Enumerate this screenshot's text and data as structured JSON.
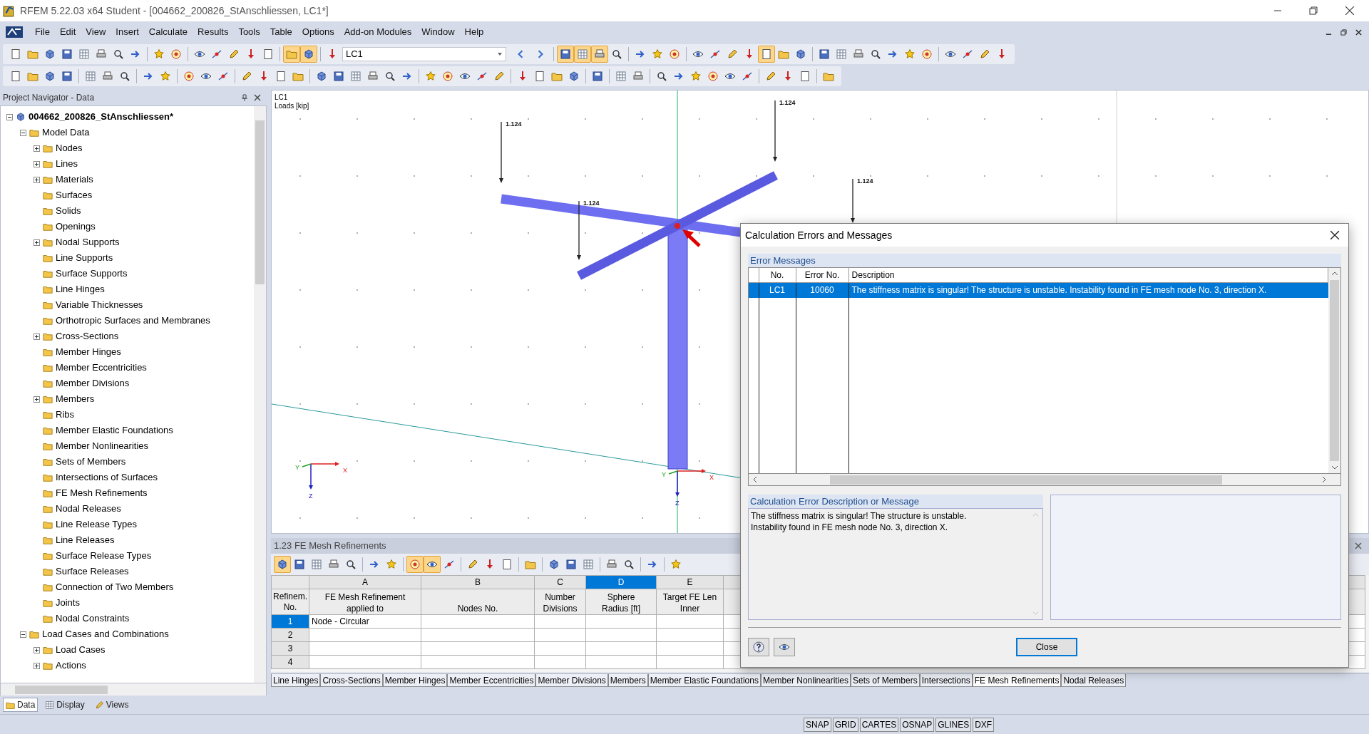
{
  "window": {
    "title": "RFEM 5.22.03 x64 Student - [004662_200826_StAnschliessen, LC1*]"
  },
  "menu": [
    "File",
    "Edit",
    "View",
    "Insert",
    "Calculate",
    "Results",
    "Tools",
    "Table",
    "Options",
    "Add-on Modules",
    "Window",
    "Help"
  ],
  "toolbar": {
    "load_case": "LC1",
    "buttons": [
      {
        "on": false
      },
      {
        "on": false
      },
      {
        "on": false
      },
      {
        "on": false
      },
      {
        "on": false
      },
      {
        "on": false
      },
      {
        "on": false
      },
      {
        "on": false
      },
      {
        "on": false
      },
      {
        "on": false
      },
      {
        "on": false
      },
      {
        "on": false
      },
      {
        "on": false
      },
      {
        "on": false
      },
      {
        "on": false
      },
      {
        "on": true
      },
      {
        "on": true
      },
      {
        "on": true
      },
      {
        "on": true
      },
      {
        "on": true
      },
      {
        "on": false
      },
      {
        "on": false
      },
      {
        "on": false
      },
      {
        "on": false
      },
      {
        "on": false
      },
      {
        "on": false
      },
      {
        "on": false
      },
      {
        "on": false
      },
      {
        "on": true
      },
      {
        "on": false
      },
      {
        "on": false
      },
      {
        "on": false
      },
      {
        "on": false
      },
      {
        "on": false
      },
      {
        "on": false
      },
      {
        "on": false
      },
      {
        "on": false
      },
      {
        "on": false
      },
      {
        "on": false
      },
      {
        "on": false
      },
      {
        "on": false
      },
      {
        "on": false
      }
    ]
  },
  "navigator": {
    "title": "Project Navigator - Data",
    "tree": [
      {
        "label": "004662_200826_StAnschliessen*",
        "kind": "group",
        "expanded": true,
        "children": [
          {
            "label": "Model Data",
            "kind": "group",
            "expanded": true,
            "children": [
              {
                "label": "Nodes",
                "kind": "group",
                "expanded": false
              },
              {
                "label": "Lines",
                "kind": "group",
                "expanded": false
              },
              {
                "label": "Materials",
                "kind": "group",
                "expanded": false
              },
              {
                "label": "Surfaces",
                "kind": "leaf"
              },
              {
                "label": "Solids",
                "kind": "leaf"
              },
              {
                "label": "Openings",
                "kind": "leaf"
              },
              {
                "label": "Nodal Supports",
                "kind": "group",
                "expanded": false
              },
              {
                "label": "Line Supports",
                "kind": "leaf"
              },
              {
                "label": "Surface Supports",
                "kind": "leaf"
              },
              {
                "label": "Line Hinges",
                "kind": "leaf"
              },
              {
                "label": "Variable Thicknesses",
                "kind": "leaf"
              },
              {
                "label": "Orthotropic Surfaces and Membranes",
                "kind": "leaf"
              },
              {
                "label": "Cross-Sections",
                "kind": "group",
                "expanded": false
              },
              {
                "label": "Member Hinges",
                "kind": "leaf"
              },
              {
                "label": "Member Eccentricities",
                "kind": "leaf"
              },
              {
                "label": "Member Divisions",
                "kind": "leaf"
              },
              {
                "label": "Members",
                "kind": "group",
                "expanded": false
              },
              {
                "label": "Ribs",
                "kind": "leaf"
              },
              {
                "label": "Member Elastic Foundations",
                "kind": "leaf"
              },
              {
                "label": "Member Nonlinearities",
                "kind": "leaf"
              },
              {
                "label": "Sets of Members",
                "kind": "leaf"
              },
              {
                "label": "Intersections of Surfaces",
                "kind": "leaf"
              },
              {
                "label": "FE Mesh Refinements",
                "kind": "leaf"
              },
              {
                "label": "Nodal Releases",
                "kind": "leaf"
              },
              {
                "label": "Line Release Types",
                "kind": "leaf"
              },
              {
                "label": "Line Releases",
                "kind": "leaf"
              },
              {
                "label": "Surface Release Types",
                "kind": "leaf"
              },
              {
                "label": "Surface Releases",
                "kind": "leaf"
              },
              {
                "label": "Connection of Two Members",
                "kind": "leaf"
              },
              {
                "label": "Joints",
                "kind": "leaf"
              },
              {
                "label": "Nodal Constraints",
                "kind": "leaf"
              }
            ]
          },
          {
            "label": "Load Cases and Combinations",
            "kind": "group",
            "expanded": true,
            "children": [
              {
                "label": "Load Cases",
                "kind": "group",
                "expanded": false
              },
              {
                "label": "Actions",
                "kind": "group",
                "expanded": false
              }
            ]
          }
        ]
      }
    ],
    "tabs": [
      {
        "label": "Data",
        "selected": true
      },
      {
        "label": "Display",
        "selected": false
      },
      {
        "label": "Views",
        "selected": false
      }
    ]
  },
  "viewport": {
    "case": "LC1",
    "units": "Loads [kip]",
    "load_labels": [
      "1.124",
      "1.124",
      "1.124",
      "1.124"
    ],
    "axes": [
      {
        "x": "X",
        "y": "Y",
        "z": "Z"
      },
      {
        "x": "X",
        "y": "Y",
        "z": "Z"
      }
    ]
  },
  "table_panel": {
    "title": "1.23 FE Mesh Refinements",
    "toolbar": [
      {
        "on": true
      },
      {
        "on": false
      },
      {
        "on": false
      },
      {
        "on": false
      },
      {
        "on": false
      },
      {
        "on": false
      },
      {
        "on": false
      },
      {
        "on": true
      },
      {
        "on": true
      },
      {
        "on": false
      },
      {
        "on": false
      },
      {
        "on": false
      },
      {
        "on": false
      },
      {
        "on": false
      },
      {
        "on": false
      },
      {
        "on": false
      },
      {
        "on": false
      },
      {
        "on": false
      },
      {
        "on": false
      },
      {
        "on": false
      },
      {
        "on": false
      }
    ],
    "row_header": [
      "Refinem.",
      "No."
    ],
    "columns": [
      {
        "letter": "A",
        "selected": false,
        "heading": [
          "FE Mesh Refinement",
          "applied to"
        ]
      },
      {
        "letter": "B",
        "selected": false,
        "heading": [
          "Nodes No."
        ]
      },
      {
        "letter": "C",
        "selected": false,
        "heading": [
          "Number",
          "Divisions"
        ]
      },
      {
        "letter": "D",
        "selected": true,
        "heading": [
          "Sphere",
          "Radius [ft]"
        ]
      },
      {
        "letter": "E",
        "selected": false,
        "heading": [
          "Target FE Len",
          "Inner"
        ]
      }
    ],
    "rows": [
      {
        "no": "1",
        "selected": true,
        "applied_to": "Node - Circular"
      },
      {
        "no": "2",
        "selected": false
      },
      {
        "no": "3",
        "selected": false
      },
      {
        "no": "4",
        "selected": false
      }
    ],
    "sheet_tabs": [
      {
        "label": "Line Hinges",
        "selected": false
      },
      {
        "label": "Cross-Sections",
        "selected": false
      },
      {
        "label": "Member Hinges",
        "selected": false
      },
      {
        "label": "Member Eccentricities",
        "selected": false
      },
      {
        "label": "Member Divisions",
        "selected": false
      },
      {
        "label": "Members",
        "selected": false
      },
      {
        "label": "Member Elastic Foundations",
        "selected": false
      },
      {
        "label": "Member Nonlinearities",
        "selected": false
      },
      {
        "label": "Sets of Members",
        "selected": false
      },
      {
        "label": "Intersections",
        "selected": false
      },
      {
        "label": "FE Mesh Refinements",
        "selected": true
      },
      {
        "label": "Nodal Releases",
        "selected": false
      }
    ]
  },
  "dialog": {
    "title": "Calculation Errors and Messages",
    "section": "Error Messages",
    "columns": [
      "No.",
      "Error No.",
      "Description"
    ],
    "rows": [
      {
        "no": "LC1",
        "error_no": "10060",
        "description": "The stiffness matrix is singular! The structure is unstable. Instability found in FE mesh node No. 3, direction X.",
        "selected": true
      }
    ],
    "detail_title": "Calculation Error Description or Message",
    "detail_lines": [
      "The stiffness matrix is singular! The structure is unstable.",
      "Instability found in FE mesh node No. 3, direction X."
    ],
    "close_button": "Close"
  },
  "status_bar": [
    "SNAP",
    "GRID",
    "CARTES",
    "OSNAP",
    "GLINES",
    "DXF"
  ]
}
